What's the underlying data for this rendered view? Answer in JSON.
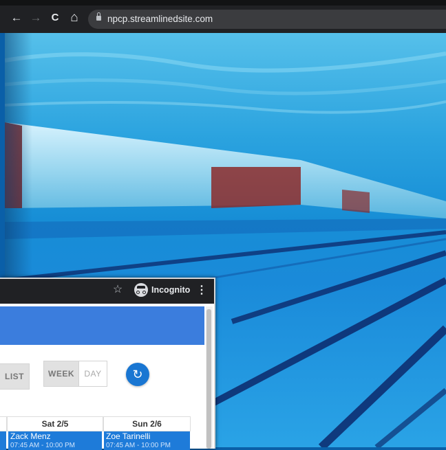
{
  "browser": {
    "url": "npcp.streamlinedsite.com",
    "nav": {
      "back": "←",
      "forward": "→",
      "reload": "C",
      "home": "⌂"
    }
  },
  "incognito_window": {
    "star": "☆",
    "incognito_label": "Incognito",
    "menu": "⋮"
  },
  "calendar": {
    "view_buttons": {
      "list": "LIST",
      "week": "WEEK",
      "day": "DAY"
    },
    "refresh_glyph": "↻",
    "columns": [
      "Sat 2/5",
      "Sun 2/6"
    ],
    "events": [
      {
        "name": "Zack Menz",
        "time": "07:45 AM - 10:00 PM"
      },
      {
        "name": "Zoe Tarinelli",
        "time": "07:45 AM - 10:00 PM"
      }
    ]
  },
  "colors": {
    "header_blue": "#3b7ddd",
    "event_blue": "#1e7bd9",
    "refresh_blue": "#1976d2"
  }
}
